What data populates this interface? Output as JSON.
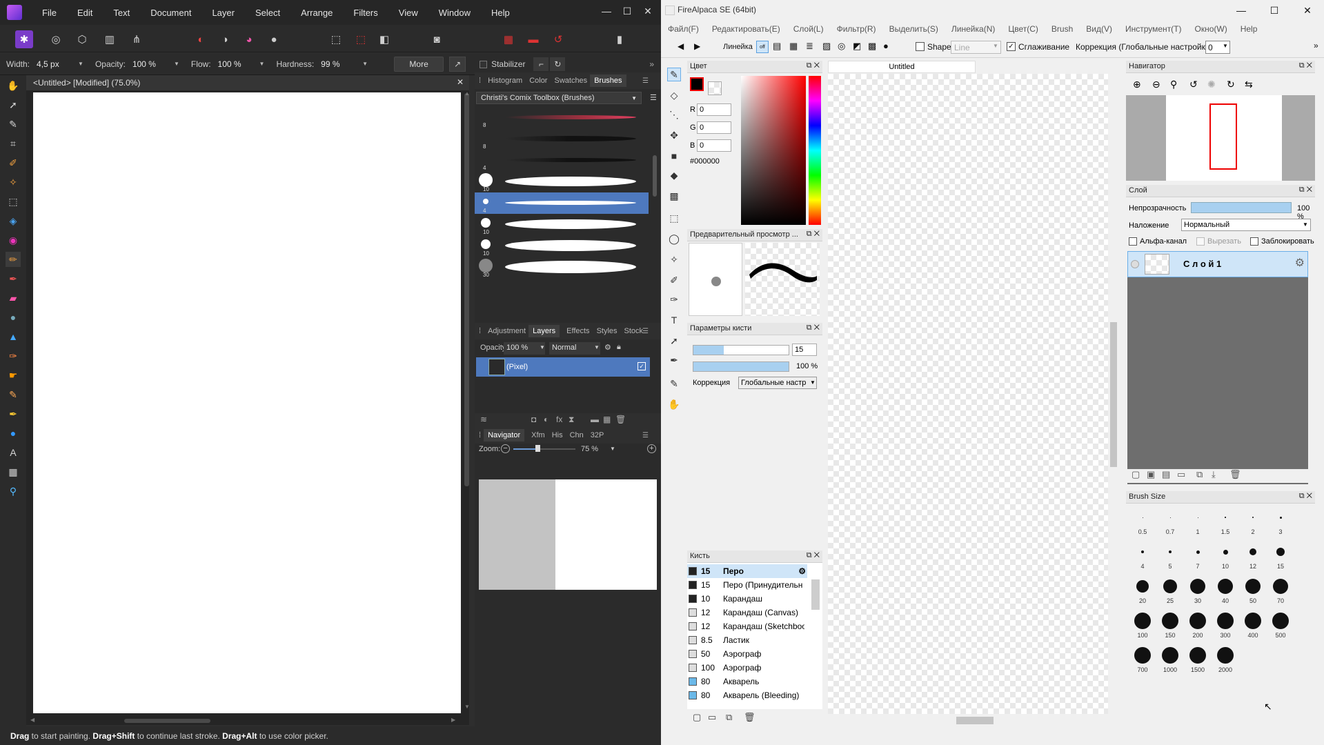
{
  "affinity": {
    "menu": [
      "File",
      "Edit",
      "Text",
      "Document",
      "Layer",
      "Select",
      "Arrange",
      "Filters",
      "View",
      "Window",
      "Help"
    ],
    "window_controls": [
      "—",
      "☐",
      "✕"
    ],
    "context": {
      "width_label": "Width:",
      "width_value": "4,5 px",
      "opacity_label": "Opacity:",
      "opacity_value": "100 %",
      "flow_label": "Flow:",
      "flow_value": "100 %",
      "hardness_label": "Hardness:",
      "hardness_value": "99 %",
      "more": "More",
      "stabilizer": "Stabilizer"
    },
    "doc_tab": "<Untitled> [Modified] (75.0%)",
    "top_tabs": [
      "Histogram",
      "Color",
      "Swatches",
      "Brushes"
    ],
    "brush_category": "Christi's Comix Toolbox (Brushes)",
    "brush_sizes": [
      "8",
      "8",
      "4",
      "10",
      "4",
      "10",
      "10",
      "30"
    ],
    "mid_tabs": [
      "Adjustment",
      "Layers",
      "Effects",
      "Styles",
      "Stock"
    ],
    "layers_opacity_label": "Opacity:",
    "layers_opacity": "100 %",
    "blend_mode": "Normal",
    "layer_name": "(Pixel)",
    "nav_tabs": [
      "Navigator",
      "Xfm",
      "His",
      "Chn",
      "32P"
    ],
    "zoom_label": "Zoom:",
    "zoom_value": "75 %",
    "status": {
      "drag1": "Drag",
      "t1": " to start painting. ",
      "drag2": "Drag+Shift",
      "t2": " to continue last stroke. ",
      "drag3": "Drag+Alt",
      "t3": " to use color picker."
    }
  },
  "fa": {
    "title": "FireAlpaca SE (64bit)",
    "menu": [
      "Файл(F)",
      "Редактировать(E)",
      "Слой(L)",
      "Фильтр(R)",
      "Выделить(S)",
      "Линейка(N)",
      "Цвет(C)",
      "Brush",
      "Вид(V)",
      "Инструмент(T)",
      "Окно(W)",
      "Help"
    ],
    "toolbar": {
      "ruler": "Линейка",
      "shape": "Shape",
      "shape_value": "Line",
      "smoothing": "Сглаживание",
      "correction": "Коррекция (Глобальные настройки)",
      "correction_value": "0"
    },
    "color_panel": "Цвет",
    "r_label": "R",
    "g_label": "G",
    "b_label": "B",
    "r": "0",
    "g": "0",
    "b": "0",
    "hex": "#000000",
    "preview_panel": "Предварительный просмотр ...",
    "brush_params_panel": "Параметры кисти",
    "brush_size": "15",
    "brush_opacity": "100 %",
    "correction_label": "Коррекция",
    "correction_select": "Глобальные настр",
    "brush_panel": "Кисть",
    "brushes": [
      {
        "size": "15",
        "name": "Перо"
      },
      {
        "size": "15",
        "name": "Перо (Принудительн"
      },
      {
        "size": "10",
        "name": "Карандаш"
      },
      {
        "size": "12",
        "name": "Карандаш (Canvas)"
      },
      {
        "size": "12",
        "name": "Карандаш (Sketchboo"
      },
      {
        "size": "8.5",
        "name": "Ластик"
      },
      {
        "size": "50",
        "name": "Аэрограф"
      },
      {
        "size": "100",
        "name": "Аэрограф"
      },
      {
        "size": "80",
        "name": "Акварель"
      },
      {
        "size": "80",
        "name": "Акварель (Bleeding)"
      }
    ],
    "canvas_tab": "Untitled",
    "navigator_panel": "Навигатор",
    "layer_panel": "Слой",
    "opacity_label": "Непрозрачность",
    "opacity_value": "100 %",
    "blend_label": "Наложение",
    "blend_value": "Нормальный",
    "alpha": "Альфа-канал",
    "clip": "Вырезать",
    "lock": "Заблокировать",
    "layer_name": "С л о й 1",
    "brushsize_panel": "Brush Size",
    "brushsizes": [
      "0.5",
      "0.7",
      "1",
      "1.5",
      "2",
      "3",
      "4",
      "5",
      "7",
      "10",
      "12",
      "15",
      "20",
      "25",
      "30",
      "40",
      "50",
      "70",
      "100",
      "150",
      "200",
      "300",
      "400",
      "500",
      "700",
      "1000",
      "1500",
      "2000"
    ]
  }
}
